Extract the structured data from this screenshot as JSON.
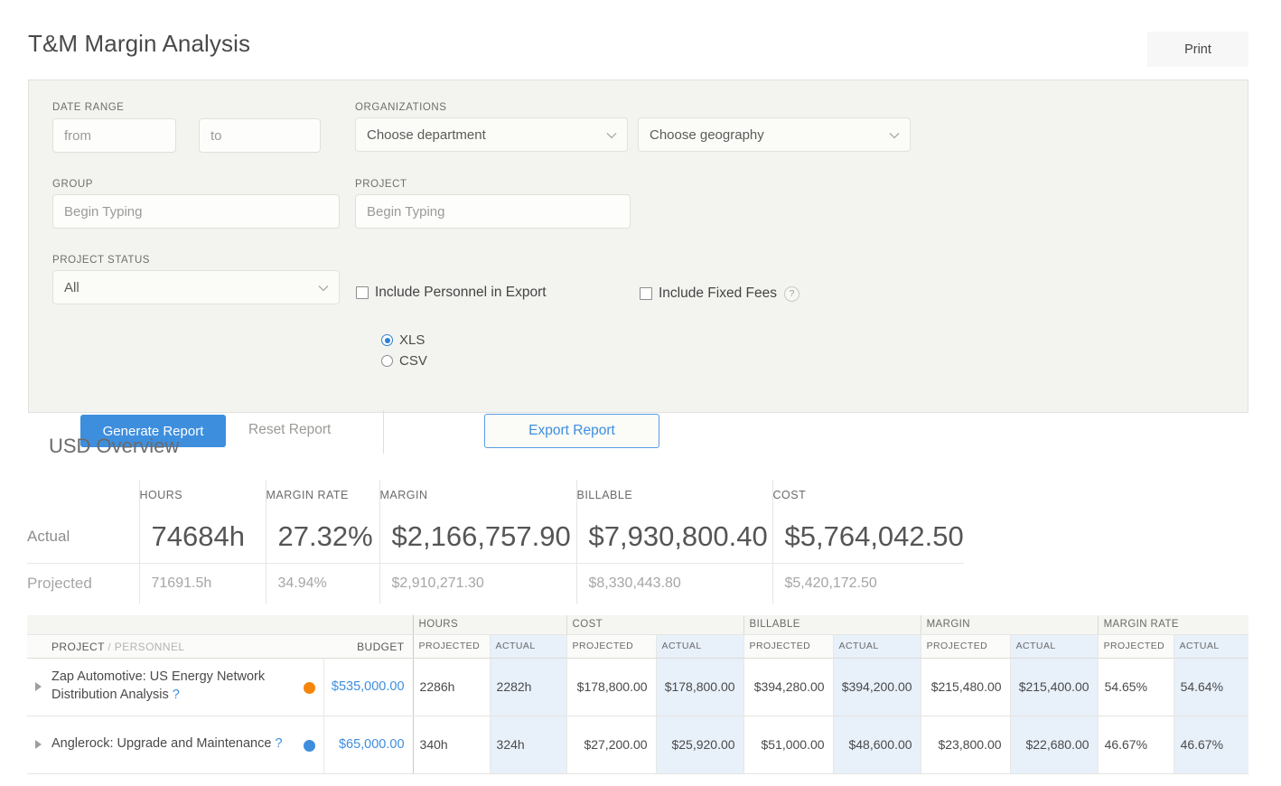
{
  "header": {
    "title": "T&M Margin Analysis",
    "print_label": "Print"
  },
  "filters": {
    "date_range_label": "DATE RANGE",
    "date_from_placeholder": "from",
    "date_to_placeholder": "to",
    "organizations_label": "ORGANIZATIONS",
    "department_value": "Choose department",
    "geography_value": "Choose geography",
    "group_label": "GROUP",
    "group_placeholder": "Begin Typing",
    "project_label": "PROJECT",
    "project_placeholder": "Begin Typing",
    "project_status_label": "PROJECT STATUS",
    "project_status_value": "All",
    "include_personnel_label": "Include Personnel in Export",
    "include_fixed_fees_label": "Include Fixed Fees",
    "help_badge": "?",
    "generate_label": "Generate Report",
    "reset_label": "Reset Report",
    "format_xls": "XLS",
    "format_csv": "CSV",
    "selected_format": "XLS",
    "export_label": "Export Report"
  },
  "overview": {
    "title": "USD Overview",
    "columns": [
      "HOURS",
      "MARGIN RATE",
      "MARGIN",
      "BILLABLE",
      "COST"
    ],
    "rows": [
      {
        "label": "Actual",
        "values": [
          "74684h",
          "27.32%",
          "$2,166,757.90",
          "$7,930,800.40",
          "$5,764,042.50"
        ]
      },
      {
        "label": "Projected",
        "values": [
          "71691.5h",
          "34.94%",
          "$2,910,271.30",
          "$8,330,443.80",
          "$5,420,172.50"
        ]
      }
    ]
  },
  "table": {
    "project_header": "PROJECT",
    "project_header_sep": " / ",
    "personnel_header": "PERSONNEL",
    "budget_header": "BUDGET",
    "groups": [
      "HOURS",
      "COST",
      "BILLABLE",
      "MARGIN",
      "MARGIN RATE"
    ],
    "sub_projected": "PROJECTED",
    "sub_actual": "ACTUAL",
    "rows": [
      {
        "name": "Zap Automotive: US Energy Network Distribution Analysis",
        "help": "?",
        "dot_color": "#f5850a",
        "budget": "$535,000.00",
        "hours_projected": "2286h",
        "hours_actual": "2282h",
        "cost_projected": "$178,800.00",
        "cost_actual": "$178,800.00",
        "billable_projected": "$394,280.00",
        "billable_actual": "$394,200.00",
        "margin_projected": "$215,480.00",
        "margin_actual": "$215,400.00",
        "margin_rate_projected": "54.65%",
        "margin_rate_actual": "54.64%"
      },
      {
        "name": "Anglerock: Upgrade and Maintenance",
        "help": "?",
        "dot_color": "#3e8ede",
        "budget": "$65,000.00",
        "hours_projected": "340h",
        "hours_actual": "324h",
        "cost_projected": "$27,200.00",
        "cost_actual": "$25,920.00",
        "billable_projected": "$51,000.00",
        "billable_actual": "$48,600.00",
        "margin_projected": "$23,800.00",
        "margin_actual": "$22,680.00",
        "margin_rate_projected": "46.67%",
        "margin_rate_actual": "46.67%"
      }
    ]
  },
  "colors": {
    "accent_blue": "#3e8ede",
    "status_orange": "#f5850a",
    "status_blue": "#3e8ede",
    "panel_bg": "#f3f4ef",
    "highlight_col": "#e8f0fa"
  }
}
